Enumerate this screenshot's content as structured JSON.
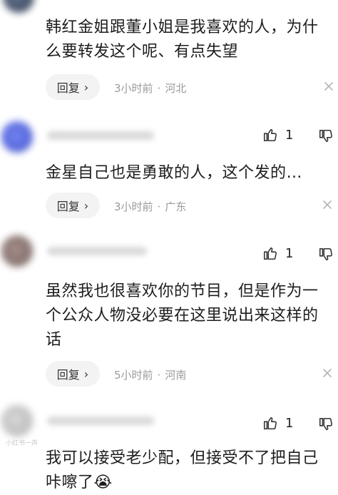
{
  "comments": [
    {
      "text": "韩红金姐跟董小姐是我喜欢的人，为什么要转发这个呢、有点失望",
      "time": "3小时前",
      "location": "河北",
      "reply_label": "回复"
    },
    {
      "text": "金星自己也是勇敢的人，这个发的…",
      "time": "3小时前",
      "location": "广东",
      "reply_label": "回复",
      "likes": "1"
    },
    {
      "text": "虽然我也很喜欢你的节目，但是作为一个公众人物没必要在这里说出来这样的话",
      "time": "5小时前",
      "location": "河南",
      "reply_label": "回复",
      "likes": "1"
    },
    {
      "text": "我可以接受老少配，但接受不了把自己咔嚓了",
      "likes": "1"
    }
  ],
  "emoji": "😭",
  "meta_separator": "·",
  "watermark": "小红书一声"
}
